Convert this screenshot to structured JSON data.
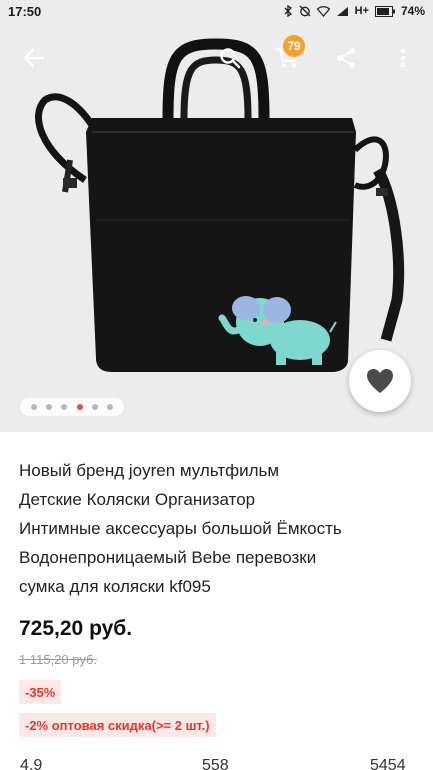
{
  "status_bar": {
    "time": "17:50",
    "network": "H+",
    "battery": "74%"
  },
  "toolbar": {
    "back_icon": "arrow-left-icon",
    "search_icon": "search-icon",
    "cart_icon": "cart-icon",
    "cart_count": "79",
    "share_icon": "share-icon",
    "more_icon": "more-vertical-icon"
  },
  "gallery": {
    "image_count": 6,
    "active_index": 3,
    "favorite_icon": "heart-icon"
  },
  "product": {
    "title_lines": [
      "Новый бренд joyren мультфильм",
      "Детские Коляски Организатор",
      "Интимные аксессуары большой Ёмкость",
      "Водонепроницаемый Bebe перевозки",
      "сумка для коляски kf095"
    ],
    "price": "725,20 руб.",
    "old_price": "1 115,20 руб.",
    "discount": "-35%",
    "wholesale": "-2% оптовая скидка(>= 2 шт.)"
  },
  "stats": {
    "rating": "4.9",
    "reviews": "558",
    "orders": "5454"
  },
  "colors": {
    "accent_red": "#e0392b",
    "badge_bg": "#fde7e7",
    "cart_badge": "#f7a02b"
  }
}
